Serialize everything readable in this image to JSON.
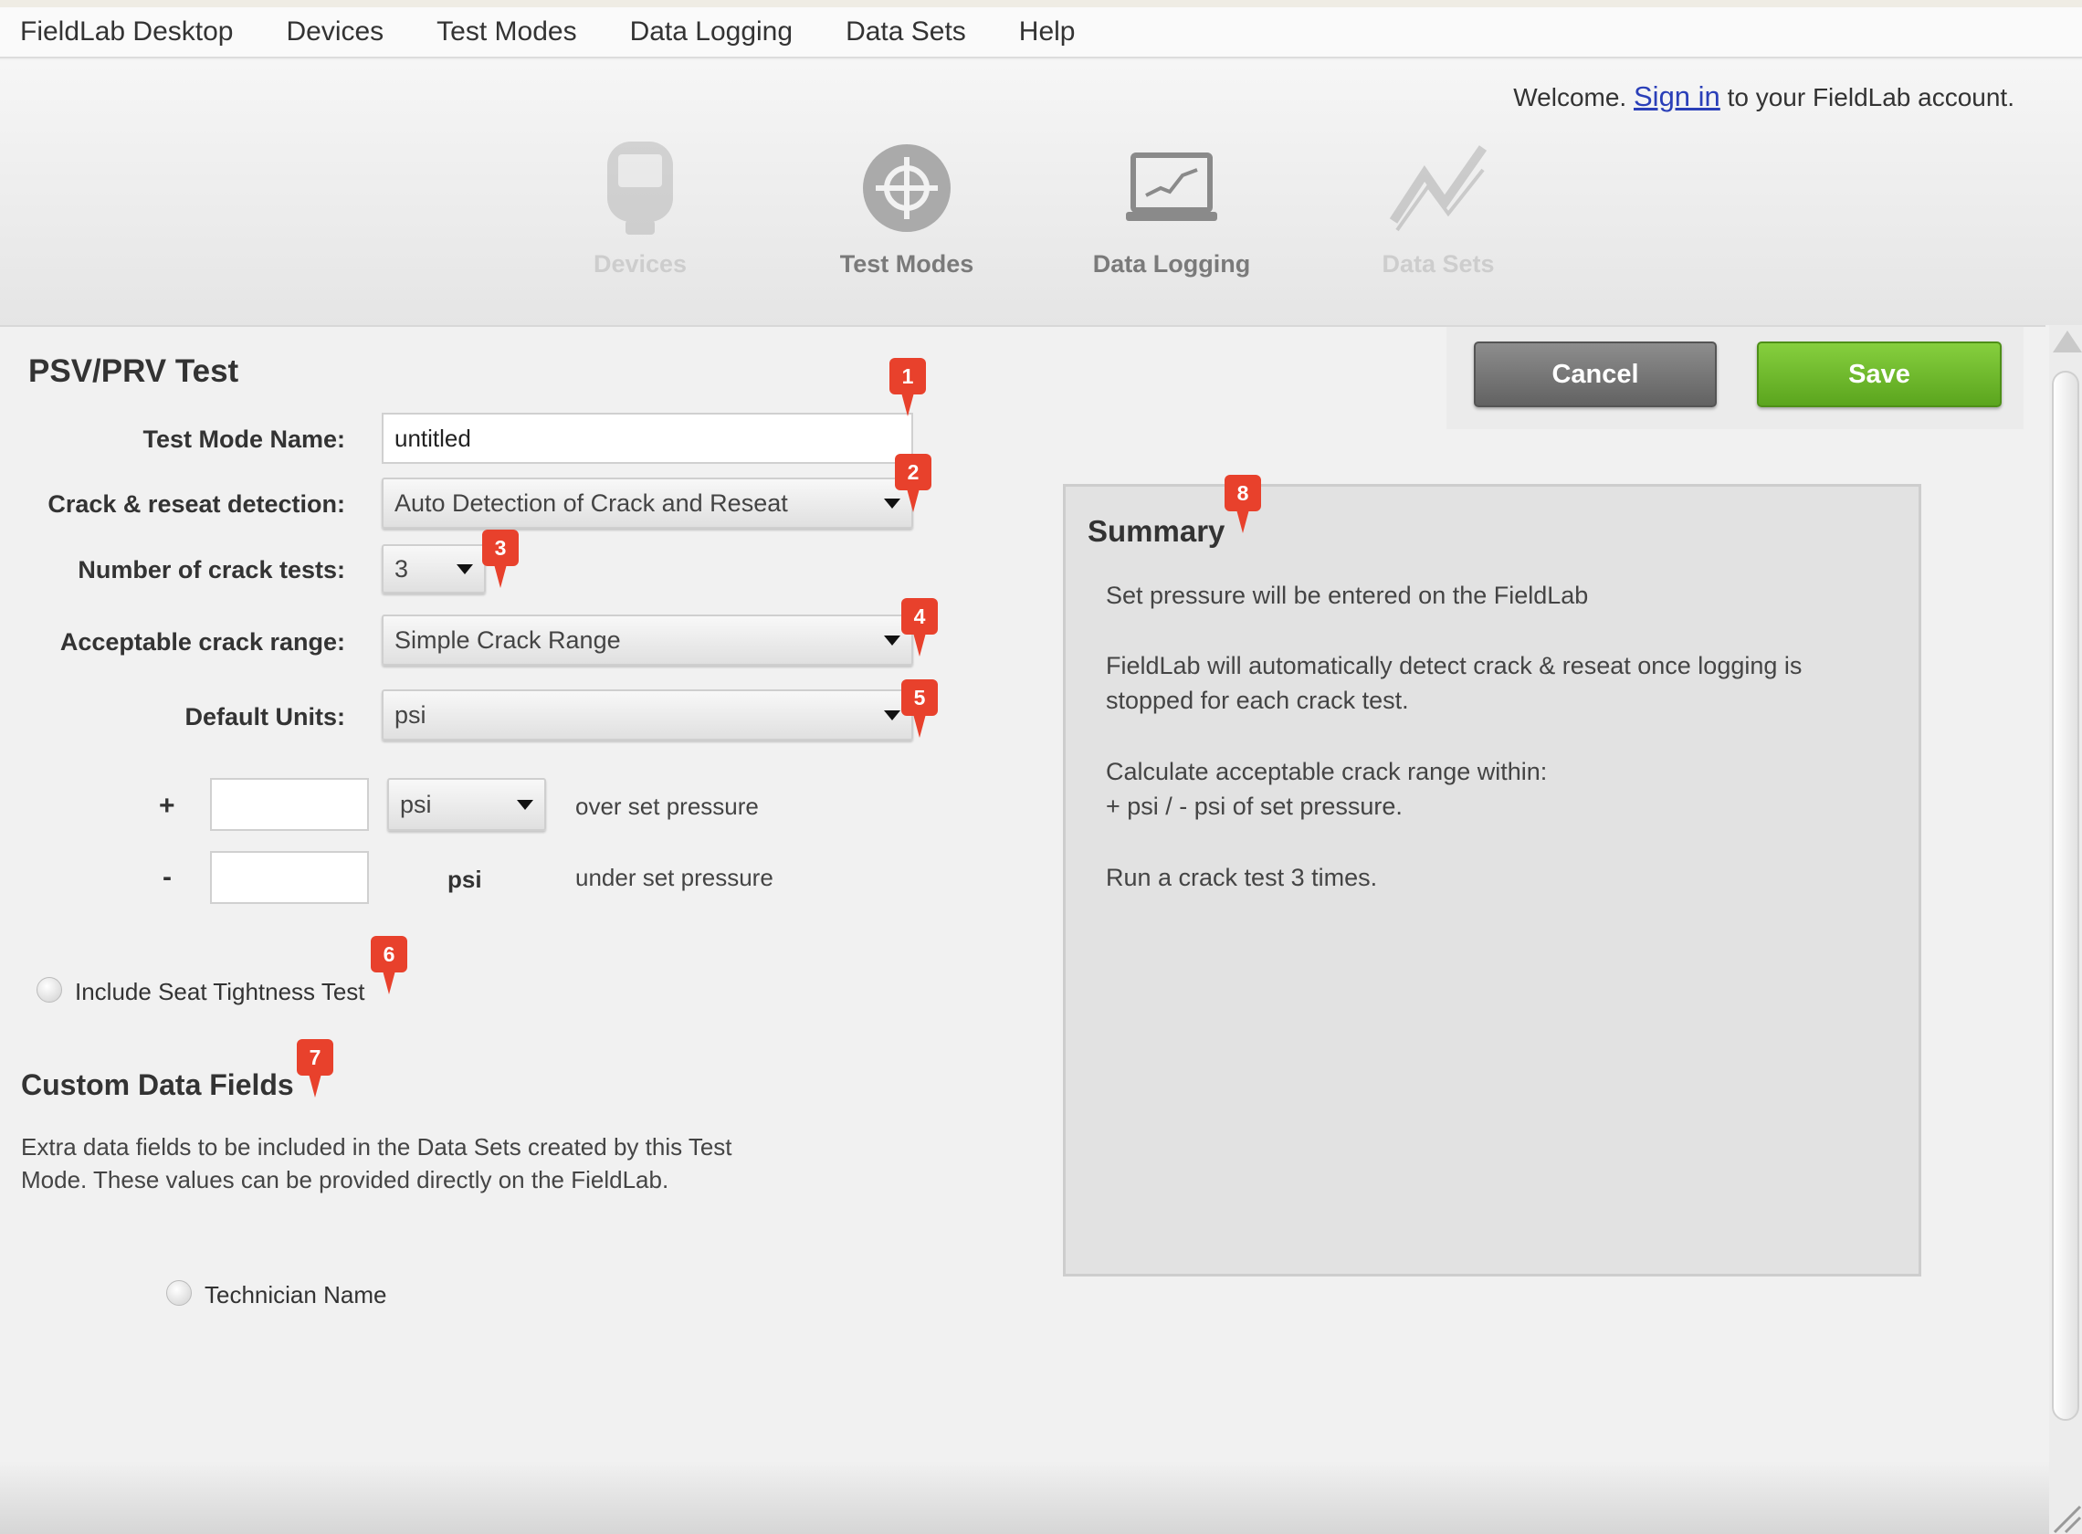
{
  "menu": [
    "FieldLab Desktop",
    "Devices",
    "Test Modes",
    "Data Logging",
    "Data Sets",
    "Help"
  ],
  "header": {
    "welcome_prefix": "Welcome.",
    "sign_in": "Sign in",
    "welcome_suffix": "to your FieldLab account.",
    "nav": [
      {
        "label": "Devices",
        "icon": "device-icon",
        "state": "disabled"
      },
      {
        "label": "Test Modes",
        "icon": "crosshair-icon",
        "state": "active"
      },
      {
        "label": "Data Logging",
        "icon": "laptop-chart-icon",
        "state": "enabled"
      },
      {
        "label": "Data Sets",
        "icon": "trend-line-icon",
        "state": "disabled"
      }
    ]
  },
  "form": {
    "title": "PSV/PRV Test",
    "name_label": "Test Mode Name:",
    "name_value": "untitled",
    "crack_label": "Crack & reseat detection:",
    "crack_value": "Auto Detection of Crack and Reseat",
    "count_label": "Number of crack tests:",
    "count_value": "3",
    "range_label": "Acceptable crack range:",
    "range_value": "Simple Crack Range",
    "units_label": "Default Units:",
    "units_value": "psi",
    "plus_sign": "+",
    "plus_unit": "psi",
    "plus_text": "over set pressure",
    "minus_sign": "-",
    "minus_unit": "psi",
    "minus_text": "under set pressure",
    "seat_label": "Include Seat Tightness Test"
  },
  "custom": {
    "title": "Custom Data Fields",
    "desc_line1": "Extra data fields to be included in the Data Sets created by this Test",
    "desc_line2": "Mode. These values can be provided directly on the FieldLab.",
    "field_label": "Technician Name"
  },
  "buttons": {
    "cancel": "Cancel",
    "save": "Save"
  },
  "summary": {
    "title": "Summary",
    "line1": "Set pressure will be entered on the FieldLab",
    "line2a": "FieldLab will automatically detect crack & reseat once logging is",
    "line2b": "stopped for each crack test.",
    "line3a": "Calculate acceptable crack range within:",
    "line3b": "+ psi / - psi of set pressure.",
    "line4": "Run a crack test 3 times."
  },
  "markers": [
    "1",
    "2",
    "3",
    "4",
    "5",
    "6",
    "7",
    "8"
  ],
  "colors": {
    "accent_marker": "#e8412c",
    "save": "#6cba2b",
    "cancel": "#777777",
    "link": "#2a3fb8"
  }
}
